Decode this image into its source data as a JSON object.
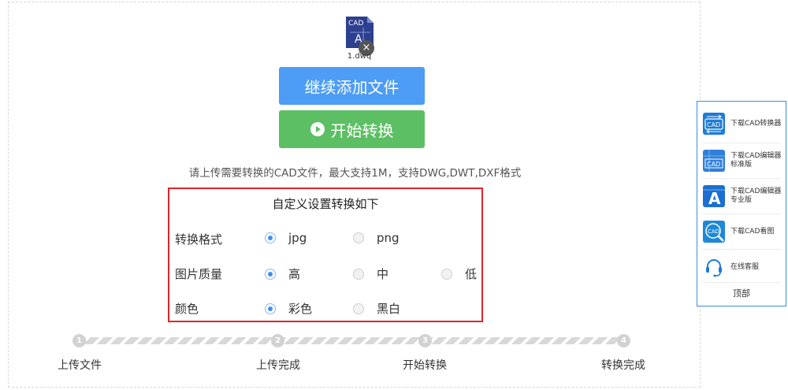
{
  "file": {
    "icon_name": "cad-file-icon",
    "icon_label": "CAD",
    "name": "1.dwq",
    "remove_glyph": "×"
  },
  "buttons": {
    "add_files": "继续添加文件",
    "start_convert": "开始转换"
  },
  "hint": "请上传需要转换的CAD文件，最大支持1M，支持DWG,DWT,DXF格式",
  "settings": {
    "title": "自定义设置转换如下",
    "rows": [
      {
        "label": "转换格式",
        "options": [
          {
            "text": "jpg",
            "checked": true
          },
          {
            "text": "png",
            "checked": false
          }
        ]
      },
      {
        "label": "图片质量",
        "options": [
          {
            "text": "高",
            "checked": true
          },
          {
            "text": "中",
            "checked": false
          },
          {
            "text": "低",
            "checked": false
          }
        ]
      },
      {
        "label": "颜色",
        "options": [
          {
            "text": "彩色",
            "checked": true
          },
          {
            "text": "黑白",
            "checked": false
          }
        ]
      }
    ]
  },
  "steps": [
    {
      "num": "1",
      "label": "上传文件"
    },
    {
      "num": "2",
      "label": "上传完成"
    },
    {
      "num": "3",
      "label": "开始转换"
    },
    {
      "num": "4",
      "label": "转换完成"
    }
  ],
  "sidebar": {
    "items": [
      {
        "icon": "cad-converter-icon",
        "icon_label": "CAD",
        "text1": "下载CAD转换器",
        "text2": ""
      },
      {
        "icon": "cad-editor-standard-icon",
        "icon_label": "CAD",
        "text1": "下载CAD编辑器",
        "text2": "标准版"
      },
      {
        "icon": "cad-editor-pro-icon",
        "icon_label": "A",
        "text1": "下载CAD编辑器",
        "text2": "专业版"
      },
      {
        "icon": "cad-viewer-icon",
        "icon_label": "CAD",
        "text1": "下载CAD看图",
        "text2": ""
      },
      {
        "icon": "headset-icon",
        "icon_label": "",
        "text1": "在线客服",
        "text2": ""
      }
    ],
    "top_label": "顶部"
  },
  "colors": {
    "accent_blue": "#4d9cf5",
    "start_green": "#5cbf63",
    "highlight_red": "#e0242b",
    "sidebar_border": "#3a8ee6"
  }
}
